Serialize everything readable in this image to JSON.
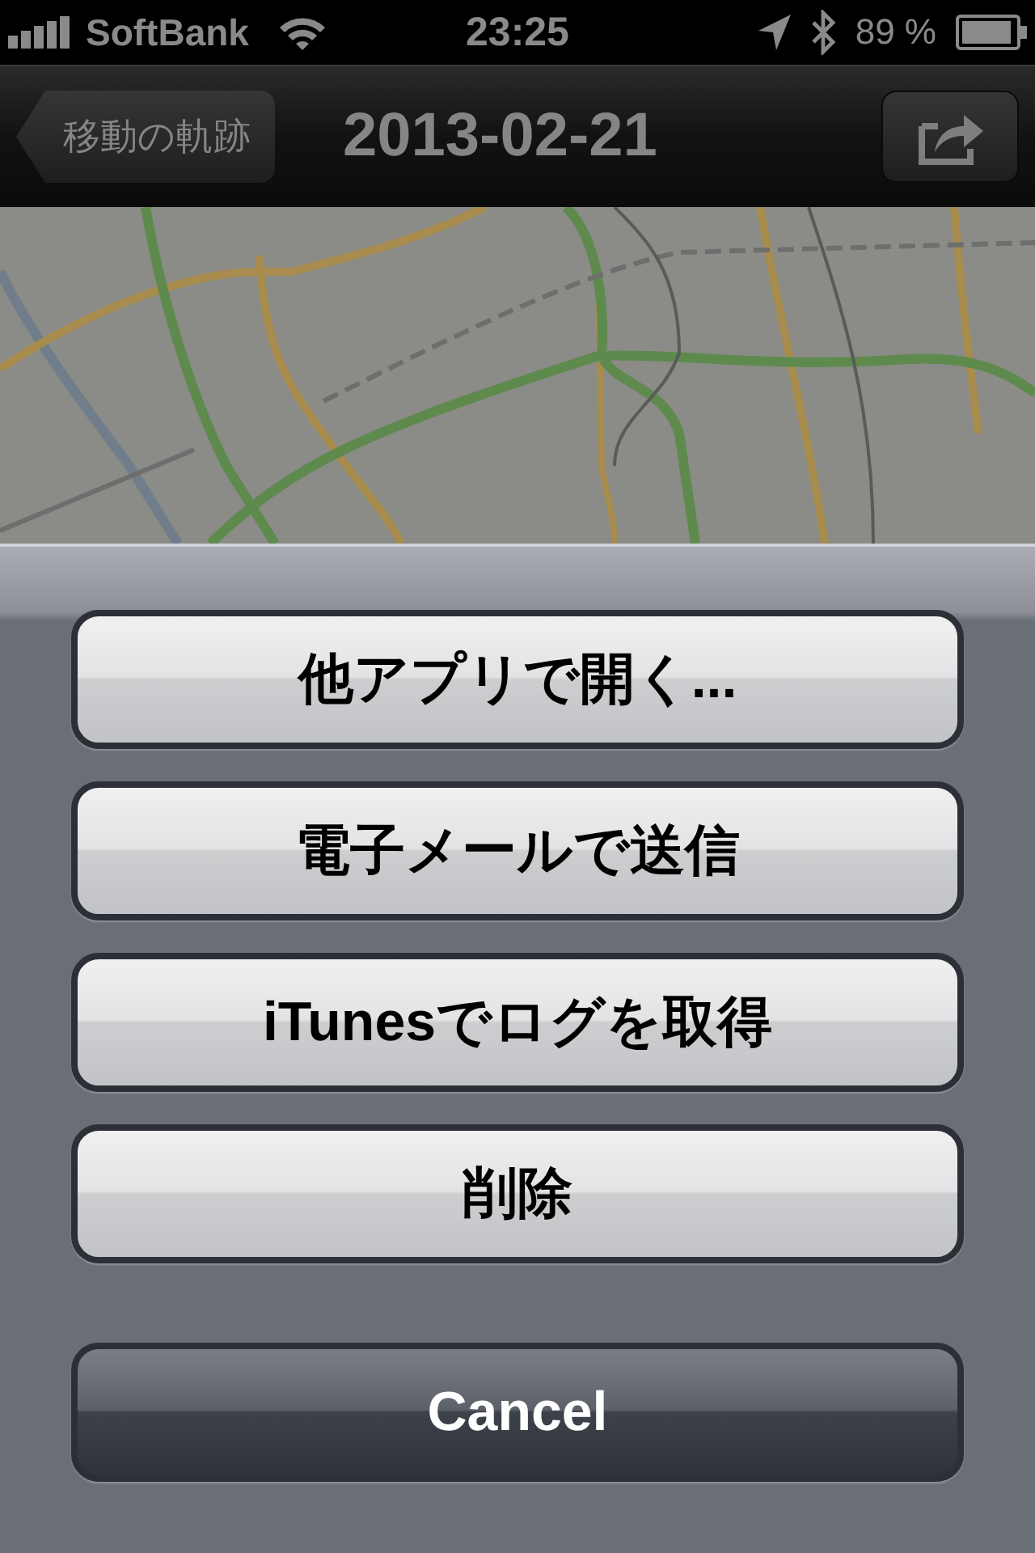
{
  "status_bar": {
    "carrier": "SoftBank",
    "time": "23:25",
    "battery": "89 %"
  },
  "nav_bar": {
    "back_button": "移動の軌跡",
    "title": "2013-02-21"
  },
  "action_sheet": {
    "buttons": [
      {
        "label": "他アプリで開く...",
        "kind": "default"
      },
      {
        "label": "電子メールで送信",
        "kind": "default"
      },
      {
        "label": "iTunesでログを取得",
        "kind": "default"
      },
      {
        "label": "削除",
        "kind": "default"
      },
      {
        "label": "Cancel",
        "kind": "cancel"
      }
    ]
  }
}
